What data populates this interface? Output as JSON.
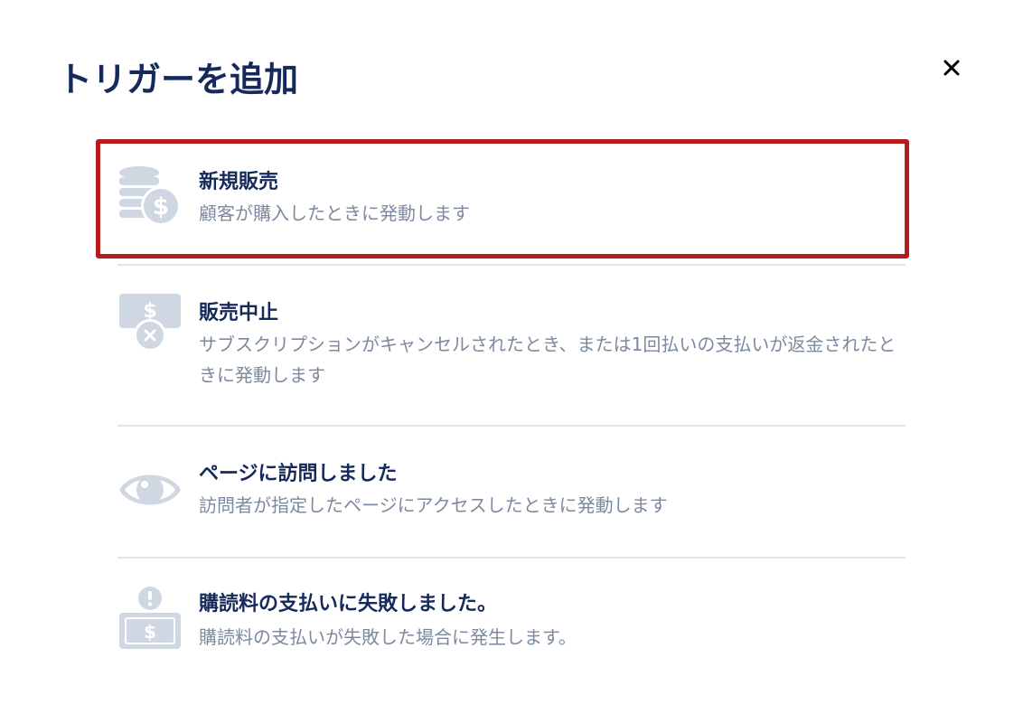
{
  "dialog": {
    "title": "トリガーを追加",
    "close_icon": "close-icon"
  },
  "triggers": [
    {
      "label": "新規販売",
      "description": "顧客が購入したときに発動します",
      "icon": "coins-dollar-icon",
      "selected": true
    },
    {
      "label": "販売中止",
      "description": "サブスクリプションがキャンセルされたとき、または1回払いの支払いが返金されたときに発動します",
      "icon": "cancelled-payment-icon",
      "selected": false
    },
    {
      "label": "ページに訪問しました",
      "description": "訪問者が指定したページにアクセスしたときに発動します",
      "icon": "eye-icon",
      "selected": false
    },
    {
      "label": "購読料の支払いに失敗しました。",
      "description": "購読料の支払いが失敗した場合に発生します。",
      "icon": "failed-payment-icon",
      "selected": false
    }
  ],
  "colors": {
    "title": "#15295a",
    "description": "#7c8aa0",
    "icon": "#cfd7e2",
    "divider": "#e1e5ea",
    "highlight": "#b71c1c"
  }
}
